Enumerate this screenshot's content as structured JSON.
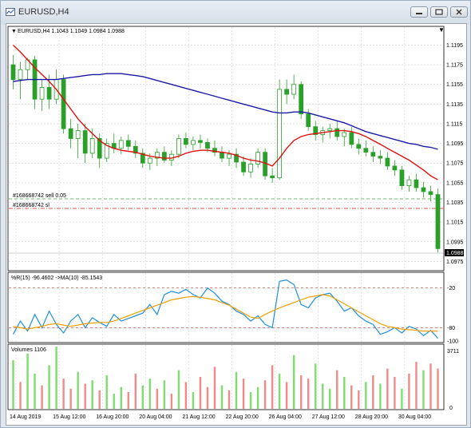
{
  "window": {
    "title": "EURUSD,H4"
  },
  "chart": {
    "symbol_line": "EURUSD,H4  1.1043 1.1049 1.0984 1.0988",
    "order_sell_label": "#168668742 sell 0.05",
    "order_sl_label": "#168668742 sl",
    "current_price": "1.0988",
    "price_ticks": [
      "1.1195",
      "1.1175",
      "1.1155",
      "1.1135",
      "1.1115",
      "1.1095",
      "1.1075",
      "1.1055",
      "1.1035",
      "1.1015",
      "1.0995",
      "1.0975"
    ],
    "wpr_label": "%R(15) -96.4602  ->MA(10) -85.1543",
    "wpr_ticks": [
      "-20",
      "-80",
      "-100"
    ],
    "volume_label": "Volumes 1106",
    "volume_ticks": [
      "3711",
      "0"
    ],
    "time_ticks": [
      "14 Aug 2019",
      "15 Aug 12:00",
      "16 Aug 20:00",
      "20 Aug 04:00",
      "21 Aug 12:00",
      "22 Aug 20:00",
      "26 Aug 04:00",
      "27 Aug 12:00",
      "28 Aug 20:00",
      "30 Aug 04:00"
    ],
    "colors": {
      "bull": "#3fa33f",
      "bear": "#2e8b57",
      "ma_fast": "#e01010",
      "ma_slow": "#1a1aa8",
      "wpr": "#1e8fe0",
      "wpr_ma": "#f0a000",
      "vol_up": "#7fdc6f",
      "vol_down": "#f08a8a",
      "sell_line": "#33aa33",
      "sl_line": "#e01010"
    },
    "candles_desc": "synthetic approximation of visible price action",
    "price_range": [
      1.0968,
      1.121
    ],
    "candles": [
      [
        1.1175,
        1.1185,
        1.115,
        1.116
      ],
      [
        1.116,
        1.1178,
        1.114,
        1.117
      ],
      [
        1.117,
        1.1182,
        1.116,
        1.118
      ],
      [
        1.118,
        1.1184,
        1.113,
        1.114
      ],
      [
        1.114,
        1.116,
        1.1128,
        1.1152
      ],
      [
        1.1152,
        1.1165,
        1.113,
        1.114
      ],
      [
        1.114,
        1.117,
        1.1135,
        1.116
      ],
      [
        1.116,
        1.1165,
        1.1105,
        1.111
      ],
      [
        1.111,
        1.112,
        1.109,
        1.11
      ],
      [
        1.11,
        1.1115,
        1.108,
        1.1108
      ],
      [
        1.1108,
        1.1115,
        1.1075,
        1.1085
      ],
      [
        1.1085,
        1.111,
        1.108,
        1.11
      ],
      [
        1.11,
        1.1105,
        1.107,
        1.108
      ],
      [
        1.108,
        1.11,
        1.1076,
        1.1095
      ],
      [
        1.1095,
        1.1105,
        1.1085,
        1.109
      ],
      [
        1.109,
        1.1102,
        1.1084,
        1.1098
      ],
      [
        1.1098,
        1.1104,
        1.1088,
        1.1092
      ],
      [
        1.1092,
        1.1098,
        1.108,
        1.1085
      ],
      [
        1.1085,
        1.109,
        1.107,
        1.1075
      ],
      [
        1.1075,
        1.1085,
        1.1068,
        1.108
      ],
      [
        1.108,
        1.109,
        1.1072,
        1.1086
      ],
      [
        1.1086,
        1.1092,
        1.1075,
        1.1078
      ],
      [
        1.1078,
        1.1088,
        1.1072,
        1.1084
      ],
      [
        1.1084,
        1.1104,
        1.108,
        1.11
      ],
      [
        1.11,
        1.1106,
        1.109,
        1.1094
      ],
      [
        1.1094,
        1.1102,
        1.1088,
        1.1098
      ],
      [
        1.1098,
        1.1104,
        1.109,
        1.1096
      ],
      [
        1.1096,
        1.11,
        1.1086,
        1.109
      ],
      [
        1.109,
        1.1098,
        1.1082,
        1.1086
      ],
      [
        1.1086,
        1.1092,
        1.1076,
        1.108
      ],
      [
        1.108,
        1.1088,
        1.1072,
        1.1084
      ],
      [
        1.1084,
        1.109,
        1.107,
        1.1076
      ],
      [
        1.1076,
        1.1082,
        1.1062,
        1.1066
      ],
      [
        1.1066,
        1.108,
        1.106,
        1.1074
      ],
      [
        1.1074,
        1.109,
        1.107,
        1.1086
      ],
      [
        1.1086,
        1.109,
        1.1058,
        1.1062
      ],
      [
        1.1062,
        1.107,
        1.1055,
        1.106
      ],
      [
        1.106,
        1.116,
        1.1058,
        1.115
      ],
      [
        1.115,
        1.116,
        1.1135,
        1.1145
      ],
      [
        1.1145,
        1.1165,
        1.114,
        1.1155
      ],
      [
        1.1155,
        1.1158,
        1.112,
        1.1125
      ],
      [
        1.1125,
        1.113,
        1.1108,
        1.1112
      ],
      [
        1.1112,
        1.1118,
        1.1098,
        1.1104
      ],
      [
        1.1104,
        1.1112,
        1.1096,
        1.1108
      ],
      [
        1.1108,
        1.1115,
        1.11,
        1.111
      ],
      [
        1.111,
        1.1118,
        1.1098,
        1.1102
      ],
      [
        1.1102,
        1.111,
        1.1092,
        1.1106
      ],
      [
        1.1106,
        1.1112,
        1.109,
        1.1094
      ],
      [
        1.1094,
        1.11,
        1.1084,
        1.109
      ],
      [
        1.109,
        1.1098,
        1.1082,
        1.1086
      ],
      [
        1.1086,
        1.1092,
        1.1076,
        1.1082
      ],
      [
        1.1082,
        1.1088,
        1.1074,
        1.108
      ],
      [
        1.108,
        1.1086,
        1.1068,
        1.1072
      ],
      [
        1.1072,
        1.1078,
        1.1062,
        1.1068
      ],
      [
        1.1068,
        1.1072,
        1.1048,
        1.1052
      ],
      [
        1.1052,
        1.1062,
        1.1046,
        1.1058
      ],
      [
        1.1058,
        1.1064,
        1.1046,
        1.105
      ],
      [
        1.105,
        1.1056,
        1.104,
        1.1046
      ],
      [
        1.1046,
        1.1052,
        1.1036,
        1.1043
      ],
      [
        1.1043,
        1.1049,
        1.0984,
        1.0988
      ]
    ],
    "ma_fast": [
      1.1195,
      1.1188,
      1.118,
      1.1172,
      1.1165,
      1.1158,
      1.115,
      1.114,
      1.113,
      1.112,
      1.1112,
      1.1105,
      1.1098,
      1.1093,
      1.109,
      1.1088,
      1.1087,
      1.1086,
      1.1084,
      1.1082,
      1.1081,
      1.108,
      1.108,
      1.1082,
      1.1085,
      1.1087,
      1.1088,
      1.1088,
      1.1087,
      1.1086,
      1.1085,
      1.1083,
      1.108,
      1.1078,
      1.1077,
      1.1075,
      1.1072,
      1.108,
      1.109,
      1.1098,
      1.1102,
      1.1104,
      1.1105,
      1.1106,
      1.1107,
      1.1108,
      1.1108,
      1.1107,
      1.1105,
      1.1102,
      1.1098,
      1.1094,
      1.109,
      1.1086,
      1.1082,
      1.1078,
      1.1073,
      1.1068,
      1.1062,
      1.1058
    ],
    "ma_slow": [
      1.1158,
      1.1159,
      1.116,
      1.116,
      1.116,
      1.116,
      1.116,
      1.1161,
      1.1162,
      1.1163,
      1.1164,
      1.1165,
      1.1165,
      1.1166,
      1.1166,
      1.1166,
      1.1165,
      1.1164,
      1.1163,
      1.1161,
      1.1159,
      1.1157,
      1.1155,
      1.1153,
      1.1151,
      1.1149,
      1.1147,
      1.1145,
      1.1143,
      1.1141,
      1.1139,
      1.1137,
      1.1135,
      1.1133,
      1.1131,
      1.1129,
      1.1127,
      1.1126,
      1.1126,
      1.1127,
      1.1127,
      1.1126,
      1.1124,
      1.1122,
      1.112,
      1.1118,
      1.1116,
      1.1113,
      1.111,
      1.1107,
      1.1105,
      1.1103,
      1.1101,
      1.1099,
      1.1097,
      1.1095,
      1.1094,
      1.1092,
      1.1091,
      1.1089
    ],
    "wpr": [
      -90,
      -70,
      -85,
      -60,
      -80,
      -55,
      -75,
      -88,
      -70,
      -60,
      -80,
      -65,
      -72,
      -78,
      -60,
      -70,
      -66,
      -62,
      -58,
      -45,
      -60,
      -30,
      -25,
      -28,
      -22,
      -30,
      -35,
      -20,
      -28,
      -40,
      -45,
      -55,
      -60,
      -70,
      -62,
      -75,
      -80,
      -10,
      -8,
      -15,
      -45,
      -50,
      -35,
      -30,
      -28,
      -40,
      -55,
      -50,
      -62,
      -70,
      -75,
      -90,
      -86,
      -80,
      -88,
      -78,
      -82,
      -92,
      -84,
      -96
    ],
    "wpr_ma": [
      -78,
      -80,
      -82,
      -80,
      -78,
      -75,
      -74,
      -76,
      -78,
      -76,
      -74,
      -73,
      -72,
      -72,
      -70,
      -66,
      -62,
      -58,
      -54,
      -50,
      -46,
      -42,
      -38,
      -36,
      -34,
      -33,
      -34,
      -36,
      -38,
      -42,
      -46,
      -52,
      -58,
      -64,
      -66,
      -60,
      -55,
      -50,
      -46,
      -42,
      -38,
      -34,
      -32,
      -30,
      -32,
      -38,
      -44,
      -50,
      -56,
      -62,
      -68,
      -74,
      -78,
      -80,
      -82,
      -83,
      -84,
      -85,
      -85,
      -85
    ],
    "volumes": [
      2900,
      1600,
      3300,
      2100,
      1400,
      2600,
      3711,
      1800,
      1200,
      2200,
      1500,
      1700,
      1100,
      2000,
      900,
      1300,
      1000,
      2100,
      1400,
      1800,
      1200,
      1700,
      900,
      2300,
      1600,
      1000,
      1900,
      1300,
      2500,
      1400,
      1100,
      2200,
      1800,
      1000,
      1300,
      1700,
      2600,
      2100,
      1600,
      3200,
      2000,
      1800,
      2700,
      1500,
      1200,
      2300,
      1900,
      1400,
      1100,
      1600,
      2000,
      1500,
      2400,
      1900,
      1200,
      2100,
      2800,
      2300,
      2700,
      2400
    ],
    "volume_up": [
      true,
      false,
      true,
      true,
      false,
      true,
      true,
      false,
      false,
      true,
      false,
      true,
      false,
      true,
      true,
      true,
      false,
      false,
      true,
      true,
      false,
      true,
      false,
      true,
      false,
      true,
      false,
      false,
      false,
      true,
      false,
      true,
      false,
      true,
      true,
      false,
      false,
      true,
      false,
      true,
      false,
      false,
      true,
      true,
      true,
      false,
      true,
      false,
      false,
      true,
      false,
      true,
      false,
      false,
      true,
      false,
      false,
      true,
      false,
      false
    ]
  }
}
